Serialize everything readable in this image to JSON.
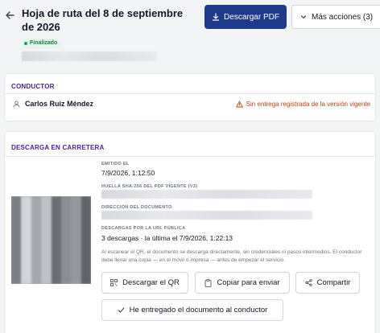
{
  "header": {
    "title": "Hoja de ruta del 8 de septiembre de 2026",
    "status_badge": "Finalizado",
    "download_pdf_label": "Descargar PDF",
    "more_actions_label": "Más acciones (3)"
  },
  "conductor": {
    "section_title": "CONDUCTOR",
    "driver_name": "Carlos Ruiz Méndez",
    "warning": "Sin entrega registrada de la versión vigente"
  },
  "descarga": {
    "section_title": "DESCARGA EN CARRETERA",
    "emitido_label": "EMITIDO EL",
    "emitido_value": "7/9/2026, 1:12:50",
    "huella_label": "HUELLA SHA-256 DEL PDF VIGENTE (V3)",
    "direccion_label": "DIRECCIÓN DEL DOCUMENTO",
    "descargas_label": "DESCARGAS POR LA URL PÚBLICA",
    "descargas_value": "3 descargas · la última el 7/9/2026, 1:22:13",
    "note": "Al escanear el QR, el documento se descarga directamente, sin credenciales ni pasos intermedios. El conductor debe llevar una copia — en el móvil o impresa — antes de empezar el servicio.",
    "btn_qr": "Descargar el QR",
    "btn_copy": "Copiar para enviar",
    "btn_share": "Compartir",
    "btn_delivered": "He entregado el documento al conductor"
  },
  "colors": {
    "primary": "#1e3a8a",
    "section_title": "#4c1d95",
    "warning": "#c2410c",
    "success": "#15803d"
  }
}
